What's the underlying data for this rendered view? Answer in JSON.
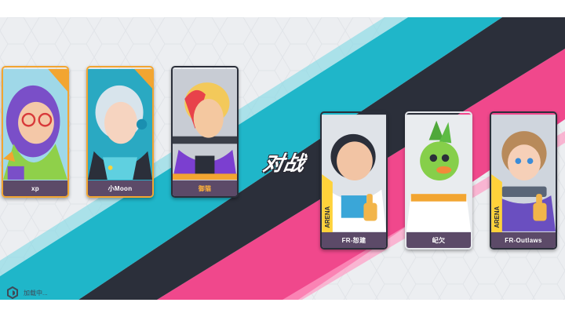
{
  "vs_label": "对战",
  "loading_label": "加载中...",
  "team_left": [
    {
      "name": "xp",
      "name_color": "white",
      "skin": "purple-hair-glasses"
    },
    {
      "name": "小Moon",
      "name_color": "white",
      "skin": "silver-hair-headphones"
    },
    {
      "name": "御猫",
      "name_color": "orange",
      "skin": "blonde-red-hair-jacket"
    }
  ],
  "team_right": [
    {
      "name": "FR-恕建",
      "skin": "astronaut-thumbs-up",
      "badge": "ARENA"
    },
    {
      "name": "屺欠",
      "skin": "green-bird-mech"
    },
    {
      "name": "FR-Outlaws",
      "skin": "gunner-girl-thumbs-up",
      "badge": "ARENA"
    }
  ],
  "colors": {
    "stripe_teal": "#1fb6c9",
    "stripe_pink": "#f0488c",
    "stripe_dark": "#2b2f3a",
    "nameplate": "#5c4a68",
    "card_border_gold": "#f2a531",
    "card_border_dark": "#2b2f3a"
  },
  "icons": {
    "loading": "hex-logo-icon",
    "thumbs_up": "thumbs-up-icon"
  }
}
